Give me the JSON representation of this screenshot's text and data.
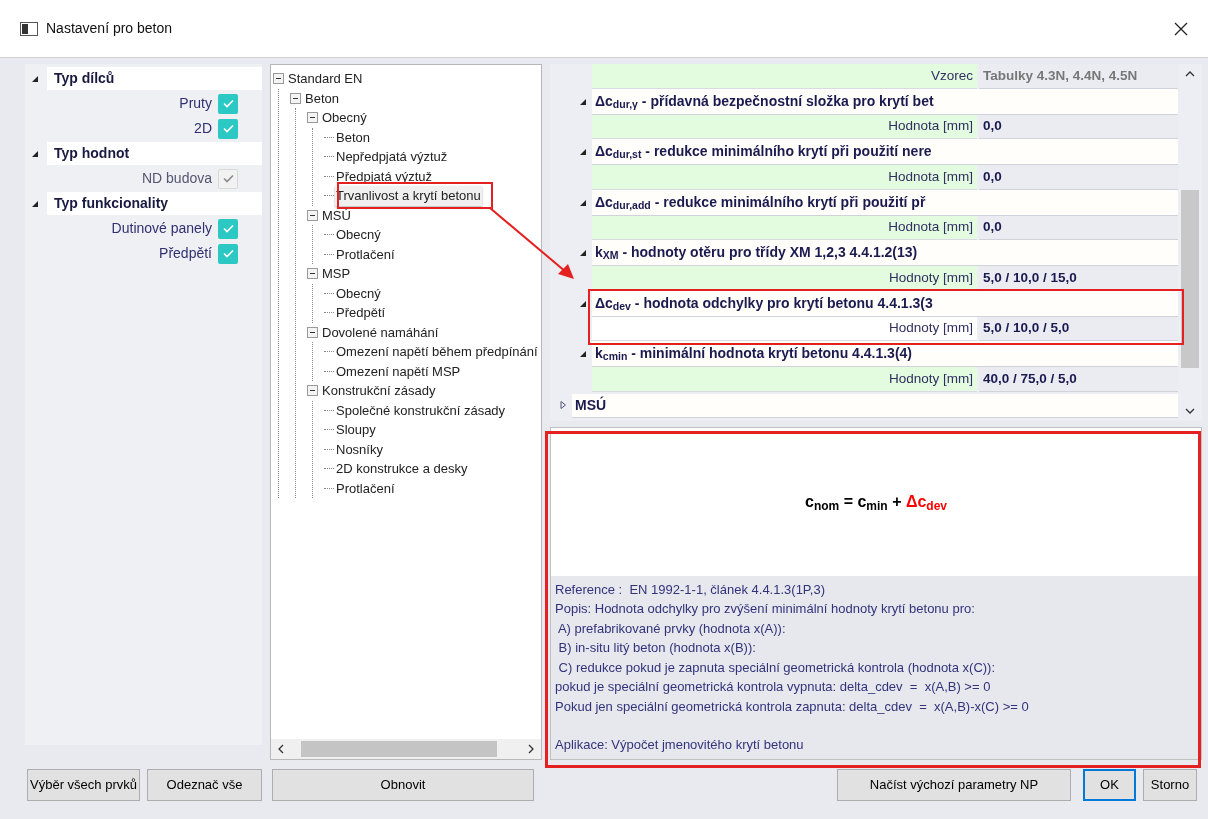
{
  "window": {
    "title": "Nastavení pro beton"
  },
  "filters": [
    {
      "title": "Typ dílců",
      "expanded": true,
      "items": [
        {
          "label": "Pruty",
          "checked": true,
          "disabled": false
        },
        {
          "label": "2D",
          "checked": true,
          "disabled": false
        }
      ]
    },
    {
      "title": "Typ hodnot",
      "expanded": true,
      "items": [
        {
          "label": "ND budova",
          "checked": true,
          "disabled": true
        }
      ]
    },
    {
      "title": "Typ funkcionality",
      "expanded": true,
      "items": [
        {
          "label": "Dutinové panely",
          "checked": true,
          "disabled": false
        },
        {
          "label": "Předpětí",
          "checked": true,
          "disabled": false
        }
      ]
    }
  ],
  "tree": [
    {
      "label": "Standard EN",
      "expanded": true,
      "selected": false,
      "children": [
        {
          "label": "Beton",
          "expanded": true,
          "selected": false,
          "children": [
            {
              "label": "Obecný",
              "expanded": true,
              "selected": false,
              "children": [
                {
                  "label": "Beton",
                  "selected": false
                },
                {
                  "label": "Nepředpjatá výztuž",
                  "selected": false
                },
                {
                  "label": "Předpjatá výztuž",
                  "selected": false
                },
                {
                  "label": "Trvanlivost a krytí betonu",
                  "selected": true
                }
              ]
            },
            {
              "label": "MSÚ",
              "expanded": true,
              "selected": false,
              "children": [
                {
                  "label": "Obecný",
                  "selected": false
                },
                {
                  "label": "Protlačení",
                  "selected": false
                }
              ]
            },
            {
              "label": "MSP",
              "expanded": true,
              "selected": false,
              "children": [
                {
                  "label": "Obecný",
                  "selected": false
                },
                {
                  "label": "Předpětí",
                  "selected": false
                }
              ]
            },
            {
              "label": "Dovolené namáhání",
              "expanded": true,
              "selected": false,
              "children": [
                {
                  "label": "Omezení napětí během předpínání",
                  "selected": false
                },
                {
                  "label": "Omezení napětí MSP",
                  "selected": false
                }
              ]
            },
            {
              "label": "Konstrukční zásady",
              "expanded": true,
              "selected": false,
              "children": [
                {
                  "label": "Společné konstrukční zásady",
                  "selected": false
                },
                {
                  "label": "Sloupy",
                  "selected": false
                },
                {
                  "label": "Nosníky",
                  "selected": false
                },
                {
                  "label": "2D konstrukce a desky",
                  "selected": false
                },
                {
                  "label": "Protlačení",
                  "selected": false
                }
              ]
            }
          ]
        }
      ]
    }
  ],
  "properties": [
    {
      "kind": "value",
      "label": "Vzorec",
      "value": "Tabulky 4.3N, 4.4N, 4.5N",
      "disabled": true,
      "selected": false
    },
    {
      "kind": "heading",
      "text": "Δc$_{dur,γ}$ - přídavná bezpečnostní složka pro krytí bet",
      "expanded": true
    },
    {
      "kind": "value",
      "label": "Hodnota [mm]",
      "value": "0,0",
      "disabled": false,
      "selected": false
    },
    {
      "kind": "heading",
      "text": "Δc$_{dur,st}$ - redukce minimálního krytí při použití nere",
      "expanded": true
    },
    {
      "kind": "value",
      "label": "Hodnota [mm]",
      "value": "0,0",
      "disabled": false,
      "selected": false
    },
    {
      "kind": "heading",
      "text": "Δc$_{dur,add}$ - redukce minimálního krytí při použití př",
      "expanded": true
    },
    {
      "kind": "value",
      "label": "Hodnota [mm]",
      "value": "0,0",
      "disabled": false,
      "selected": false
    },
    {
      "kind": "heading",
      "text": "k$_{XM}$ - hodnoty otěru pro třídy XM 1,2,3 4.4.1.2(13)",
      "expanded": true
    },
    {
      "kind": "value",
      "label": "Hodnoty [mm]",
      "value": "5,0 / 10,0 / 15,0",
      "disabled": false,
      "selected": false
    },
    {
      "kind": "heading",
      "text": "Δc$_{dev}$ - hodnota odchylky pro krytí betonu 4.4.1.3(3",
      "expanded": true
    },
    {
      "kind": "value",
      "label": "Hodnoty [mm]",
      "value": "5,0 / 10,0 / 5,0",
      "disabled": false,
      "selected": true
    },
    {
      "kind": "heading",
      "text": "k$_{cmin}$ - minimální hodnota krytí betonu 4.4.1.3(4)",
      "expanded": true
    },
    {
      "kind": "value",
      "label": "Hodnoty [mm]",
      "value": "40,0 / 75,0 / 5,0",
      "disabled": false,
      "selected": false
    },
    {
      "kind": "category",
      "text": "MSÚ",
      "expanded": false
    }
  ],
  "formula": [
    {
      "text": "c$_{nom}$ = c$_{min}$ + ",
      "color": "#000000"
    },
    {
      "text": "Δc$_{dev}$",
      "color": "#ff0000"
    }
  ],
  "description": [
    "Reference :  EN 1992-1-1, článek 4.4.1.3(1P,3)",
    "Popis: Hodnota odchylky pro zvýšení minimální hodnoty krytí betonu pro:",
    " A) prefabrikované prvky (hodnota x(A)):",
    " B) in-situ litý beton (hodnota x(B)):",
    " C) redukce pokud je zapnuta speciální geometrická kontrola (hodnota x(C)):",
    "pokud je speciální geometrická kontrola vypnuta: delta_cdev  =  x(A,B) >= 0",
    "Pokud jen speciální geometrická kontrola zapnuta: delta_cdev  =  x(A,B)-x(C) >= 0"
  ],
  "application": "Aplikace: Výpočet jmenovitého krytí betonu",
  "buttons_left": [
    "Výběr všech prvků",
    "Odeznač vše"
  ],
  "refresh_button": "Obnovit",
  "buttons_right": [
    {
      "label": "Načíst výchozí parametry NP",
      "default": false
    },
    {
      "label": "OK",
      "default": true
    },
    {
      "label": "Storno",
      "default": false
    }
  ]
}
